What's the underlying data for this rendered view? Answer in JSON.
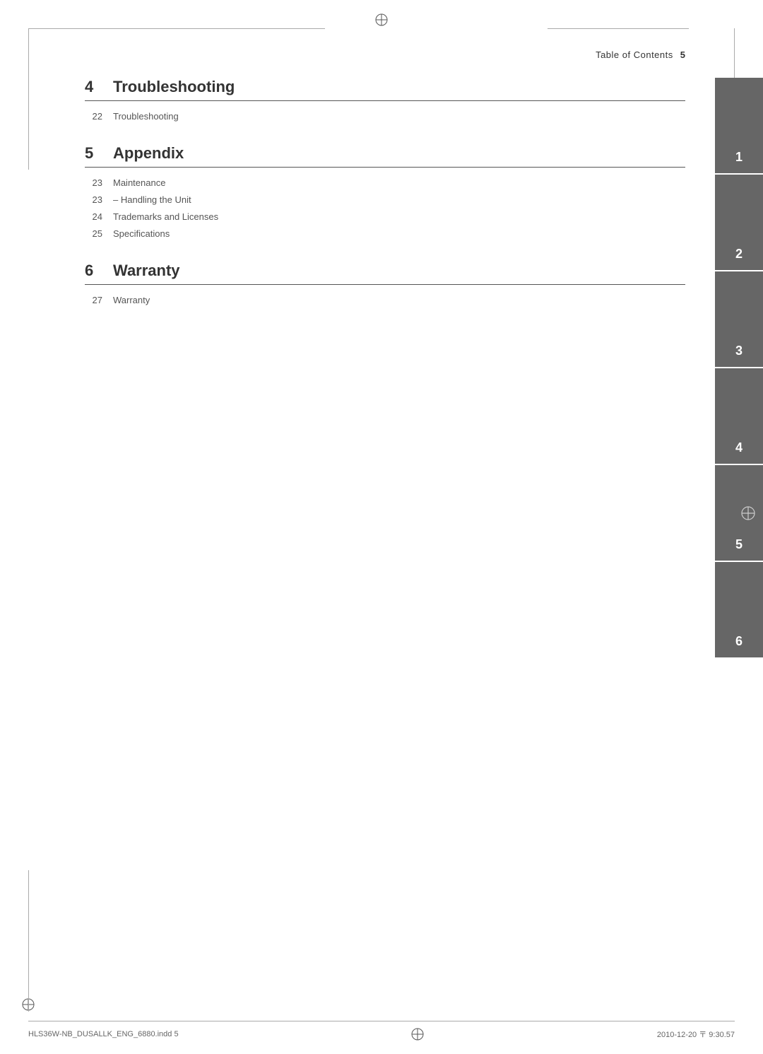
{
  "header": {
    "title": "Table of Contents",
    "page_number": "5"
  },
  "sections": [
    {
      "number": "4",
      "title": "Troubleshooting",
      "items": [
        {
          "page": "22",
          "title": "Troubleshooting"
        }
      ]
    },
    {
      "number": "5",
      "title": "Appendix",
      "items": [
        {
          "page": "23",
          "title": "Maintenance"
        },
        {
          "page": "23",
          "title": "– Handling the Unit"
        },
        {
          "page": "24",
          "title": "Trademarks and Licenses"
        },
        {
          "page": "25",
          "title": "Specifications"
        }
      ]
    },
    {
      "number": "6",
      "title": "Warranty",
      "items": [
        {
          "page": "27",
          "title": "Warranty"
        }
      ]
    }
  ],
  "side_tabs": [
    {
      "number": "1"
    },
    {
      "number": "2"
    },
    {
      "number": "3"
    },
    {
      "number": "4"
    },
    {
      "number": "5"
    },
    {
      "number": "6"
    }
  ],
  "footer": {
    "left": "HLS36W-NB_DUSALLK_ENG_6880.indd   5",
    "right": "2010-12-20   〒 9:30.57"
  }
}
